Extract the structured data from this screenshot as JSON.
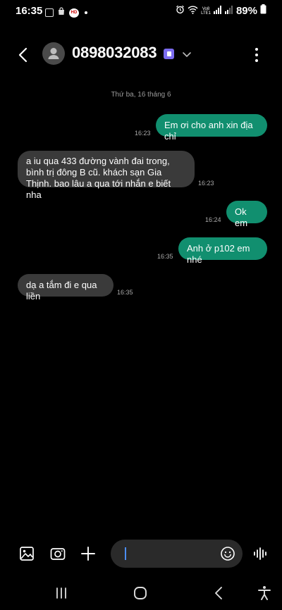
{
  "status_bar": {
    "time": "16:35",
    "left_icons": [
      "gallery-icon",
      "bag-icon",
      "hd-icon"
    ],
    "hd_label": "HD",
    "right_icons": [
      "alarm-icon",
      "wifi-icon",
      "volte-icon",
      "signal-icon",
      "signal-icon",
      "battery-icon"
    ],
    "volte_label_1": "Vo8",
    "volte_label_2": "LTE1",
    "battery": "89%"
  },
  "header": {
    "contact": "0898032083",
    "back_icon": "chevron-left-icon",
    "avatar_icon": "person-icon",
    "sim_icon": "sim-icon",
    "dropdown_icon": "chevron-down-icon",
    "more_icon": "more-vertical-icon"
  },
  "conversation": {
    "date": "Thứ ba, 16 tháng 6",
    "messages": [
      {
        "dir": "out",
        "text": "Em ơi cho anh xin địa chỉ",
        "time": "16:23"
      },
      {
        "dir": "in",
        "text": "a iu qua 433 đường vành đai trong, bình trị đông B cũ. khách sạn Gia Thịnh. bao lâu a qua tới nhắn e biết nha",
        "time": "16:23"
      },
      {
        "dir": "out",
        "text": "Ok em",
        "time": "16:24"
      },
      {
        "dir": "out",
        "text": "Anh ở p102 em nhé",
        "time": "16:35"
      },
      {
        "dir": "in",
        "text": "dạ a tắm đi e qua liền",
        "time": "16:35"
      }
    ]
  },
  "composer": {
    "gallery_icon": "image-icon",
    "camera_icon": "camera-icon",
    "add_icon": "plus-icon",
    "input_value": "",
    "emoji_icon": "emoji-icon",
    "voice_icon": "voice-wave-icon"
  },
  "nav": {
    "recents_icon": "recents-icon",
    "home_icon": "home-icon",
    "back_icon": "back-icon",
    "accessibility_icon": "accessibility-icon"
  },
  "colors": {
    "background": "#000000",
    "outgoing_bubble": "#118f6f",
    "incoming_bubble": "#3a3a3a",
    "sim_badge": "#7b6cf0",
    "cursor": "#4c8df6"
  }
}
